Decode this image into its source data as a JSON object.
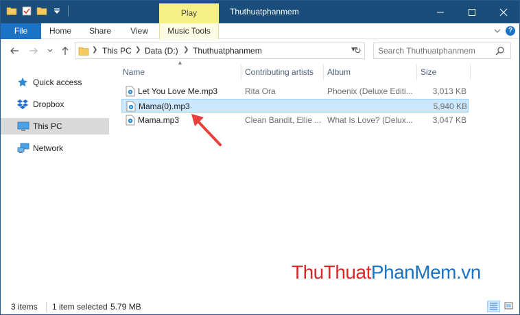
{
  "window": {
    "title": "Thuthuatphanmem",
    "contextual_tab_group": "Play",
    "controls": {
      "minimize": "—",
      "maximize": "☐",
      "close": "✕"
    }
  },
  "ribbon": {
    "tabs": [
      "File",
      "Home",
      "Share",
      "View",
      "Music Tools"
    ],
    "help": "?"
  },
  "address": {
    "breadcrumb": [
      "This PC",
      "Data (D:)",
      "Thuthuatphanmem"
    ],
    "search_placeholder": "Search Thuthuatphanmem"
  },
  "navigation": {
    "items": [
      {
        "label": "Quick access",
        "icon": "star-icon"
      },
      {
        "label": "Dropbox",
        "icon": "dropbox-icon"
      },
      {
        "label": "This PC",
        "icon": "computer-icon",
        "selected": true
      },
      {
        "label": "Network",
        "icon": "network-icon"
      }
    ]
  },
  "columns": [
    "Name",
    "Contributing artists",
    "Album",
    "Size"
  ],
  "files": [
    {
      "name": "Let You Love Me.mp3",
      "artist": "Rita Ora",
      "album": "Phoenix (Deluxe Editi...",
      "size": "3,013 KB",
      "selected": false
    },
    {
      "name": "Mama(0).mp3",
      "artist": "",
      "album": "",
      "size": "5,940 KB",
      "selected": true
    },
    {
      "name": "Mama.mp3",
      "artist": "Clean Bandit, Ellie ...",
      "album": "What Is Love? (Delux...",
      "size": "3,047 KB",
      "selected": false
    }
  ],
  "status": {
    "item_count": "3 items",
    "selection": "1 item selected",
    "selection_size": "5.79 MB"
  },
  "watermark": {
    "part1": "Thu",
    "part2": "Thuat",
    "part3": "PhanMem",
    "part4": ".vn"
  },
  "colors": {
    "titlebar": "#1a4d7a",
    "file_tab": "#1a73c4",
    "play_tab": "#f7f089",
    "selection": "#cce8ff",
    "arrow": "#e8403c",
    "watermark_red": "#d9292b",
    "watermark_blue": "#1a73c4"
  }
}
